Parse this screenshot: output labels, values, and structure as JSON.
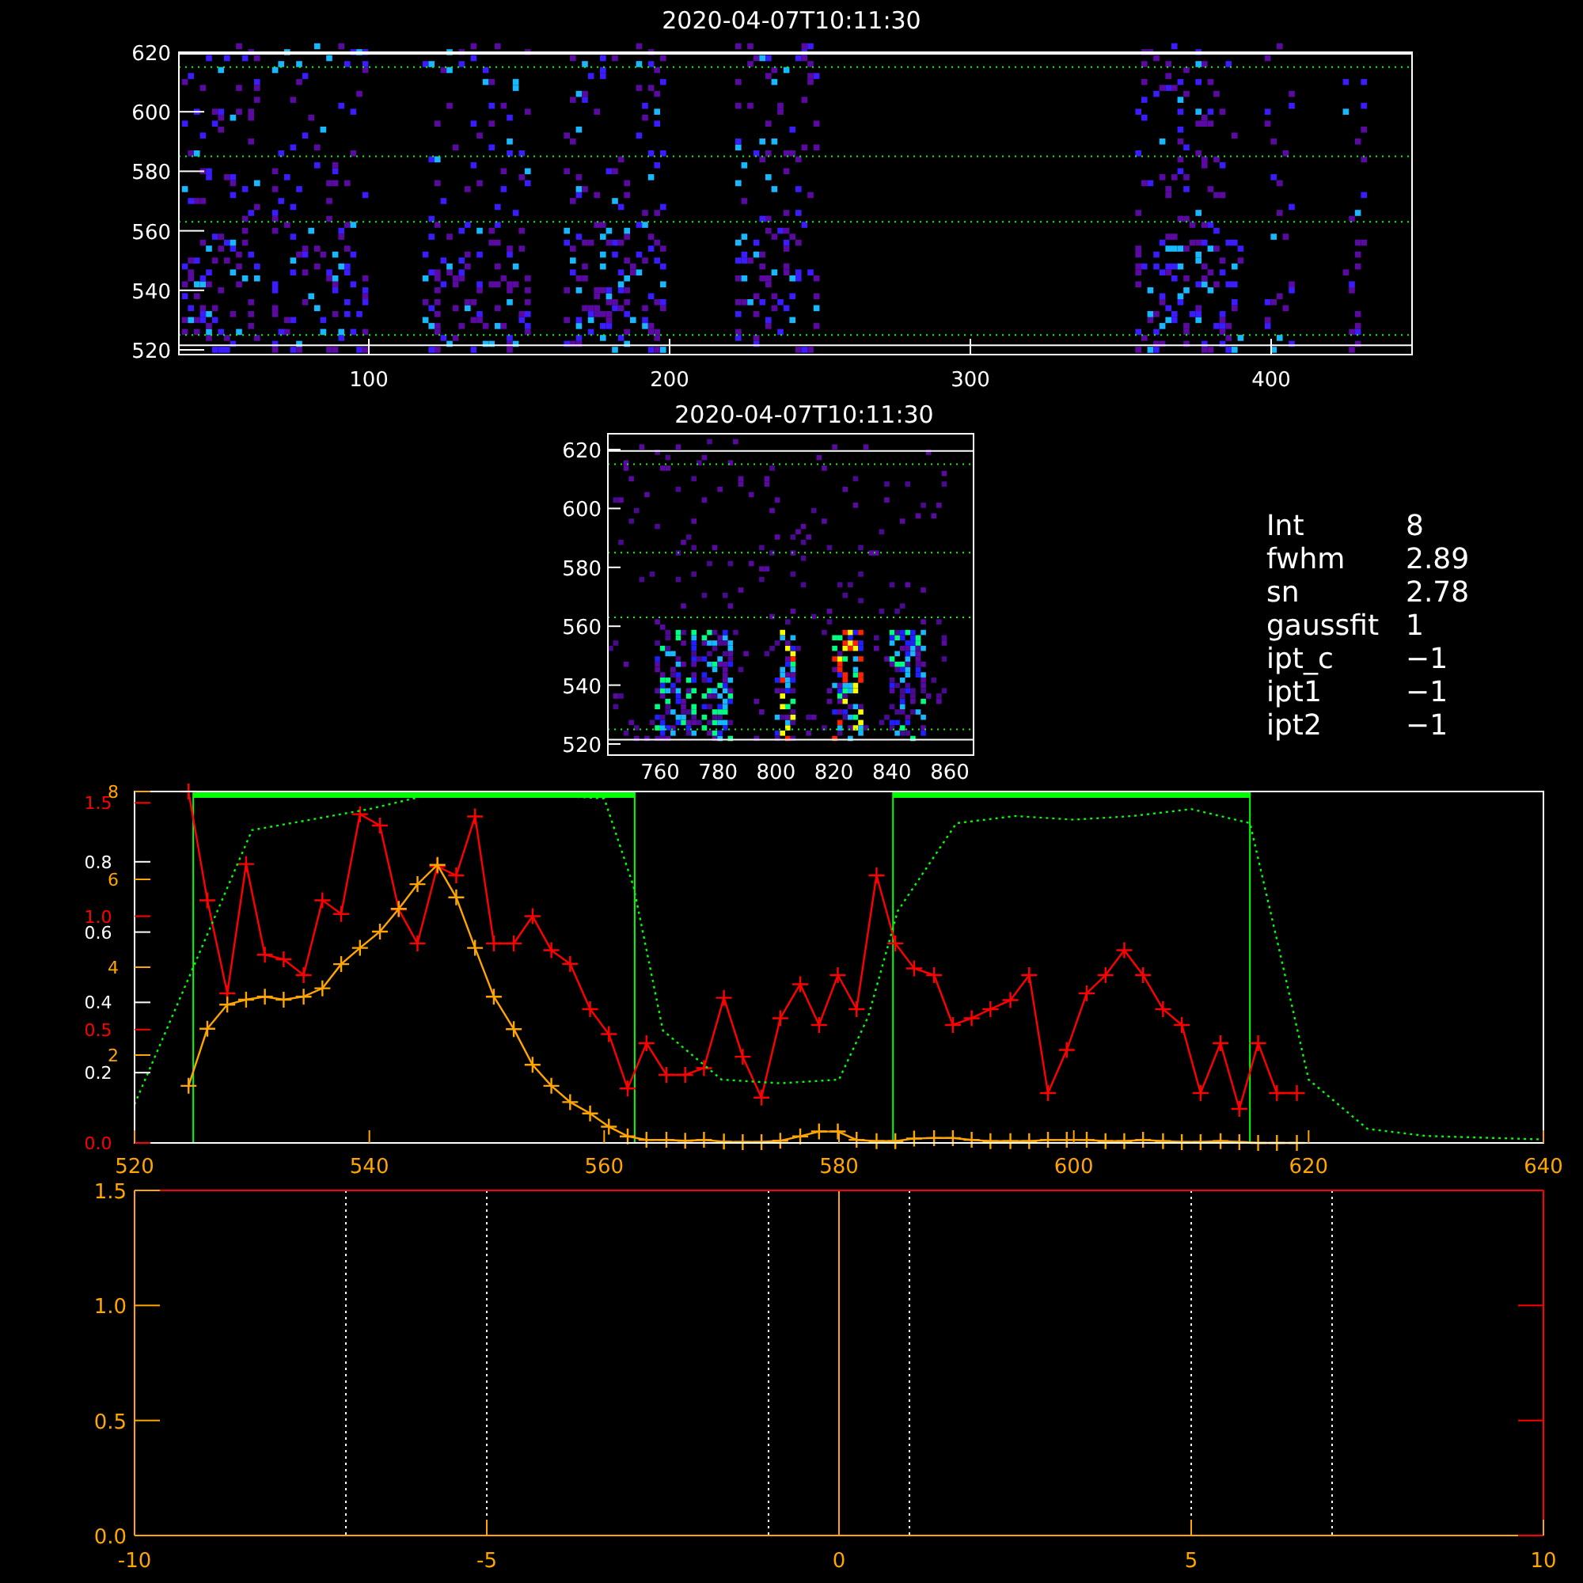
{
  "image_panel": {
    "title": "2020-04-07T10:11:30",
    "xticks": [
      "100",
      "200",
      "300",
      "400"
    ],
    "yticks": [
      "620",
      "600",
      "580",
      "560",
      "540",
      "520"
    ]
  },
  "zoom_panel": {
    "title": "2020-04-07T10:11:30",
    "xticks": [
      "760",
      "780",
      "800",
      "820",
      "840",
      "860"
    ],
    "yticks": [
      "620",
      "600",
      "580",
      "560",
      "540",
      "520"
    ]
  },
  "fit_info": [
    {
      "label": "Int",
      "value": "8"
    },
    {
      "label": "fwhm",
      "value": "2.89"
    },
    {
      "label": "sn",
      "value": "2.78"
    },
    {
      "label": "gaussfit",
      "value": "1"
    },
    {
      "label": "ipt_c",
      "value": "−1"
    },
    {
      "label": "ipt1",
      "value": "−1"
    },
    {
      "label": "ipt2",
      "value": "−1"
    }
  ],
  "spectrum_plot": {
    "chart_data": {
      "type": "line",
      "xlim": [
        520,
        640
      ],
      "ylim": [
        0,
        1.55
      ],
      "xticks": [
        520,
        540,
        560,
        580,
        600,
        620,
        640
      ],
      "yticks": [
        {
          "value": 0,
          "label": "0.0"
        },
        {
          "value": 0.5,
          "label": "0.5"
        },
        {
          "value": 1,
          "label": "1.0"
        },
        {
          "value": 1.5,
          "label": "1.5"
        }
      ],
      "y2lim": [
        0,
        1
      ],
      "y2ticks": [
        {
          "value": 0.2,
          "label": "0.2"
        },
        {
          "value": 0.4,
          "label": "0.4"
        },
        {
          "value": 0.6,
          "label": "0.6"
        },
        {
          "value": 0.8,
          "label": "0.8"
        }
      ],
      "y3lim": [
        0,
        8
      ],
      "y3ticks": [
        {
          "value": 2,
          "label": "2"
        },
        {
          "value": 4,
          "label": "4"
        },
        {
          "value": 6,
          "label": "6"
        },
        {
          "value": 8,
          "label": "8"
        }
      ],
      "x": [
        524.6,
        526.2,
        527.9,
        529.5,
        531.1,
        532.7,
        534.4,
        536.0,
        537.6,
        539.2,
        540.9,
        542.5,
        544.1,
        545.8,
        547.4,
        549.0,
        550.6,
        552.3,
        553.9,
        555.5,
        557.1,
        558.8,
        560.4,
        562.0,
        563.6,
        565.3,
        566.9,
        568.5,
        570.2,
        571.8,
        573.4,
        575.0,
        576.7,
        578.3,
        579.9,
        581.5,
        583.2,
        584.8,
        586.4,
        588.1,
        589.7,
        591.3,
        592.9,
        594.6,
        596.2,
        597.8,
        599.4,
        601.1,
        602.7,
        604.3,
        605.9,
        607.6,
        609.2,
        610.8,
        612.5,
        614.1,
        615.7,
        617.3,
        619.0
      ],
      "series": [
        {
          "color": "#ff0000",
          "marker": "plus",
          "values": [
            1.55,
            1.07,
            0.66,
            1.23,
            0.83,
            0.81,
            0.74,
            1.07,
            1.01,
            1.45,
            1.4,
            1.03,
            0.88,
            1.22,
            1.18,
            1.44,
            0.88,
            0.88,
            1.0,
            0.85,
            0.79,
            0.59,
            0.48,
            0.24,
            0.44,
            0.3,
            0.3,
            0.33,
            0.64,
            0.38,
            0.2,
            0.55,
            0.7,
            0.52,
            0.74,
            0.59,
            1.18,
            0.88,
            0.77,
            0.74,
            0.52,
            0.55,
            0.59,
            0.63,
            0.74,
            0.22,
            0.41,
            0.66,
            0.74,
            0.85,
            0.74,
            0.59,
            0.52,
            0.22,
            0.44,
            0.15,
            0.44,
            0.22,
            0.22
          ]
        },
        {
          "color": "#ffa500",
          "axis": "y3",
          "marker": "plus",
          "values": [
            1.3,
            2.6,
            3.15,
            3.26,
            3.33,
            3.26,
            3.33,
            3.52,
            4.07,
            4.44,
            4.81,
            5.33,
            5.89,
            6.33,
            5.59,
            4.44,
            3.33,
            2.59,
            1.78,
            1.3,
            0.93,
            0.67,
            0.37,
            0.15,
            0.07,
            0.07,
            0.05,
            0.07,
            0.03,
            0.02,
            0.02,
            0.05,
            0.15,
            0.26,
            0.26,
            0.07,
            0.04,
            0.04,
            0.1,
            0.11,
            0.11,
            0.07,
            0.04,
            0.04,
            0.04,
            0.07,
            0.07,
            0.07,
            0.04,
            0.04,
            0.07,
            0.04,
            0.02,
            0.02,
            0.04,
            0.02,
            0.0,
            0.0,
            0.0
          ]
        },
        {
          "color": "#00ff00",
          "axis": "y2",
          "line_style": "dotted",
          "x": [
            520,
            525,
            530,
            535,
            540,
            545,
            550,
            555,
            560,
            562.5,
            565,
            570,
            575,
            580,
            582.5,
            585,
            590,
            595,
            600,
            605,
            610,
            615,
            617.5,
            620,
            625,
            630,
            640
          ],
          "values": [
            0.11,
            0.5,
            0.89,
            0.92,
            0.95,
            0.99,
            0.99,
            0.99,
            0.98,
            0.73,
            0.32,
            0.18,
            0.17,
            0.18,
            0.36,
            0.66,
            0.91,
            0.93,
            0.92,
            0.93,
            0.95,
            0.91,
            0.55,
            0.18,
            0.04,
            0.02,
            0.01
          ]
        }
      ],
      "ref_lines": [
        {
          "axis": "x",
          "value": 525,
          "color": "#00ff00"
        },
        {
          "axis": "x",
          "value": 562.6,
          "color": "#00ff00"
        },
        {
          "axis": "x",
          "value": 584.6,
          "color": "#00ff00"
        },
        {
          "axis": "x",
          "value": 615,
          "color": "#00ff00"
        }
      ]
    }
  },
  "profile_plot": {
    "chart_data": {
      "type": "line",
      "xlim": [
        -10,
        10
      ],
      "ylim": [
        0,
        1.5
      ],
      "xticks": [
        -10,
        -5,
        0,
        5,
        10
      ],
      "yticks": [
        {
          "value": 0,
          "label": "0.0"
        },
        {
          "value": 0.5,
          "label": "0.5"
        },
        {
          "value": 1,
          "label": "1.0"
        },
        {
          "value": 1.5,
          "label": "1.5"
        }
      ],
      "ref_lines": [
        {
          "axis": "x",
          "value": -7,
          "color": "#ffffff",
          "line_style": "dotted"
        },
        {
          "axis": "x",
          "value": -5,
          "color": "#ffffff",
          "line_style": "dotted"
        },
        {
          "axis": "x",
          "value": -1,
          "color": "#ffffff",
          "line_style": "dotted"
        },
        {
          "axis": "x",
          "value": 0,
          "color": "#ffa500",
          "line_style": "solid"
        },
        {
          "axis": "x",
          "value": 1,
          "color": "#ffffff",
          "line_style": "dotted"
        },
        {
          "axis": "x",
          "value": 5,
          "color": "#ffffff",
          "line_style": "dotted"
        },
        {
          "axis": "x",
          "value": 7,
          "color": "#ffffff",
          "line_style": "dotted"
        }
      ]
    }
  }
}
